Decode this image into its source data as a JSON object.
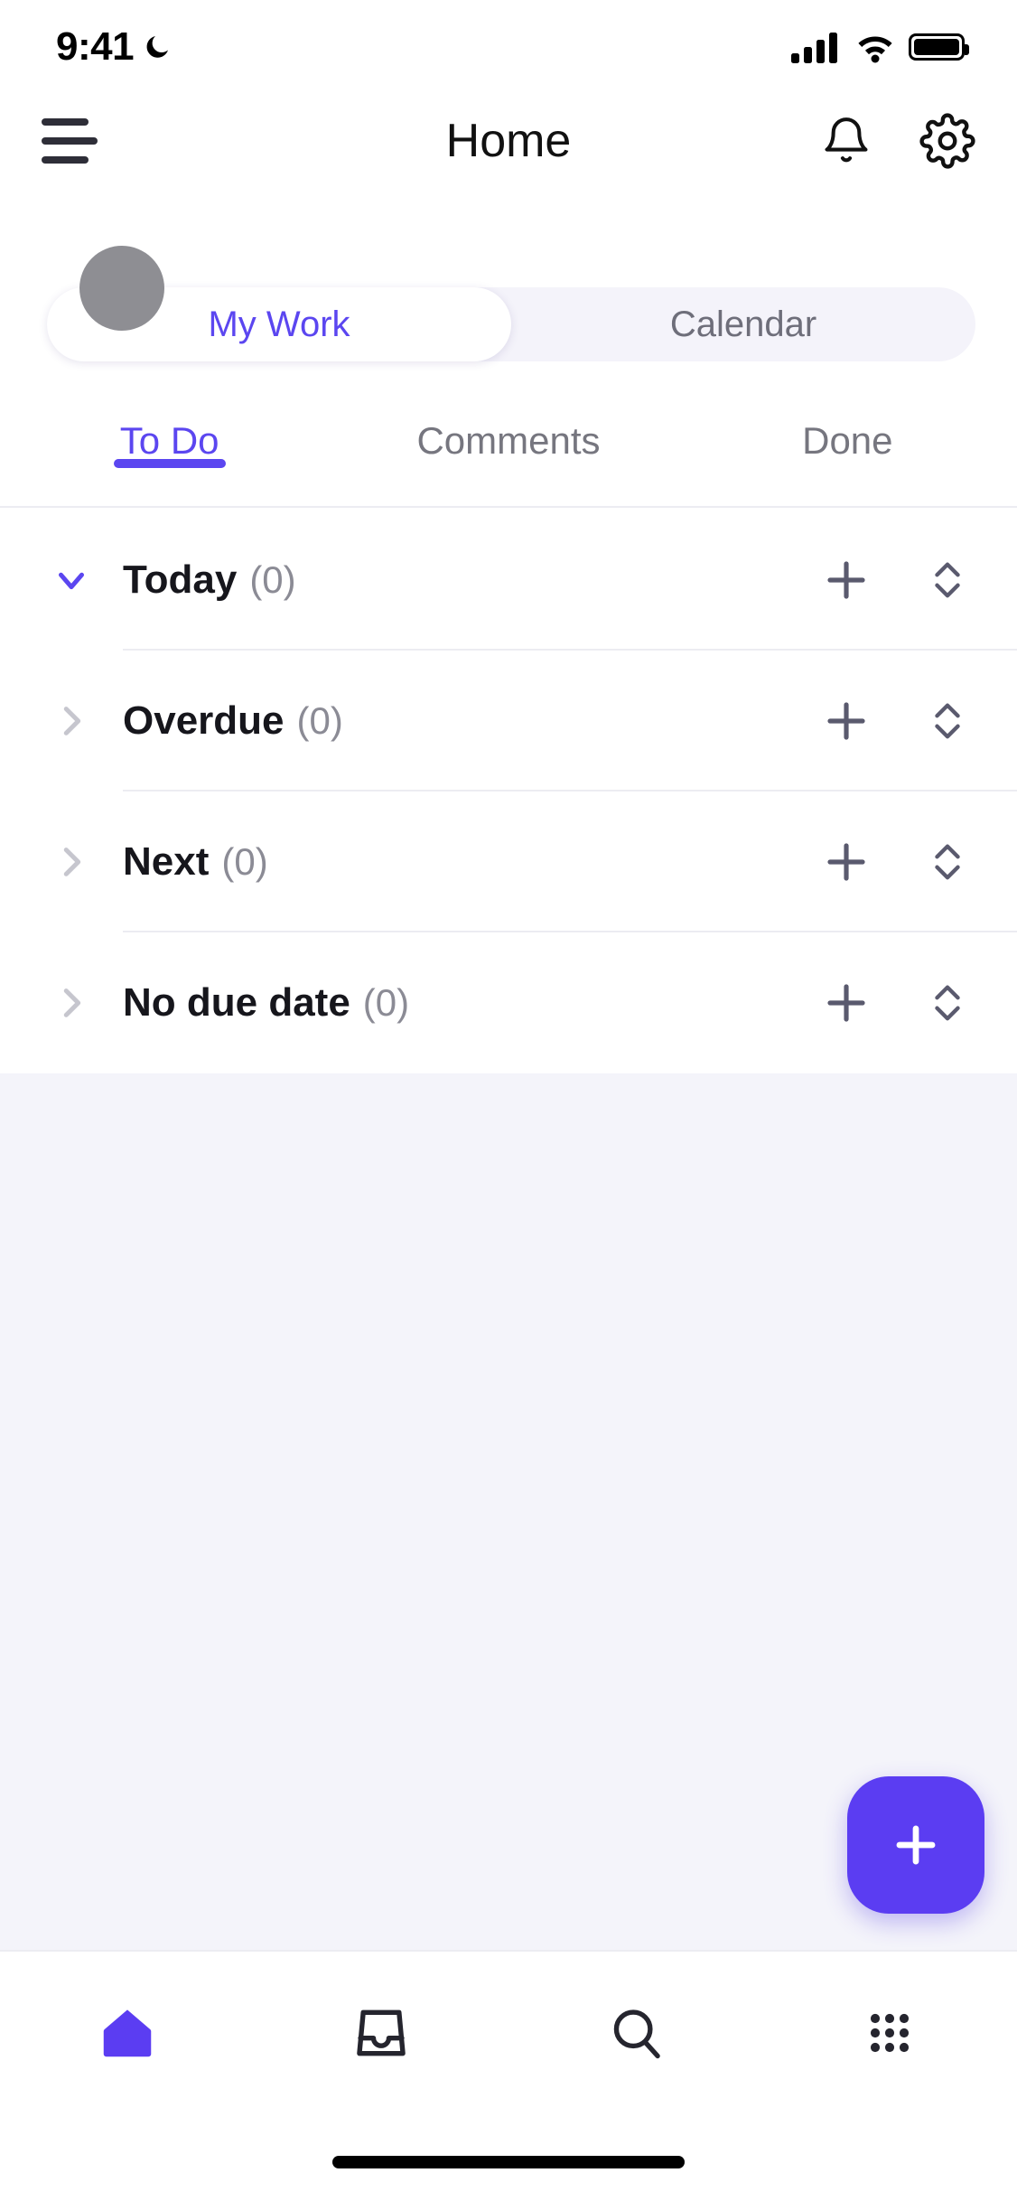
{
  "status_bar": {
    "time": "9:41",
    "dnd_icon": "moon-icon",
    "signal_icon": "cellular-signal-icon",
    "wifi_icon": "wifi-icon",
    "battery_icon": "battery-full-icon"
  },
  "header": {
    "menu_icon": "hamburger-menu-icon",
    "title": "Home",
    "notifications_icon": "bell-icon",
    "settings_icon": "gear-icon"
  },
  "avatar": {
    "name": "user-avatar"
  },
  "segmented_control": {
    "active_index": 0,
    "options": [
      {
        "label": "My Work",
        "active": true
      },
      {
        "label": "Calendar",
        "active": false
      }
    ]
  },
  "tabs": {
    "active_index": 0,
    "items": [
      {
        "label": "To Do",
        "active": true
      },
      {
        "label": "Comments",
        "active": false
      },
      {
        "label": "Done",
        "active": false
      }
    ]
  },
  "sections": [
    {
      "title": "Today",
      "count": "(0)",
      "expanded": true,
      "chevron": "chevron-down-icon",
      "add_icon": "plus-icon",
      "sort_icon": "sort-updown-icon"
    },
    {
      "title": "Overdue",
      "count": "(0)",
      "expanded": false,
      "chevron": "chevron-right-icon",
      "add_icon": "plus-icon",
      "sort_icon": "sort-updown-icon"
    },
    {
      "title": "Next",
      "count": "(0)",
      "expanded": false,
      "chevron": "chevron-right-icon",
      "add_icon": "plus-icon",
      "sort_icon": "sort-updown-icon"
    },
    {
      "title": "No due date",
      "count": "(0)",
      "expanded": false,
      "chevron": "chevron-right-icon",
      "add_icon": "plus-icon",
      "sort_icon": "sort-updown-icon"
    }
  ],
  "fab": {
    "icon": "plus-icon",
    "label": ""
  },
  "bottom_nav": {
    "active_index": 0,
    "items": [
      {
        "icon": "home-icon",
        "active": true
      },
      {
        "icon": "inbox-tray-icon",
        "active": false
      },
      {
        "icon": "search-icon",
        "active": false
      },
      {
        "icon": "grid-apps-icon",
        "active": false
      }
    ]
  },
  "colors": {
    "accent": "#5B46F0",
    "fab": "#5B3DF2",
    "content_bg": "#F4F4FA",
    "segment_bg": "#F4F3FA",
    "text_primary": "#16161C",
    "text_muted": "#8B8B95",
    "divider": "#ECECF2",
    "avatar": "#8E8E93"
  }
}
